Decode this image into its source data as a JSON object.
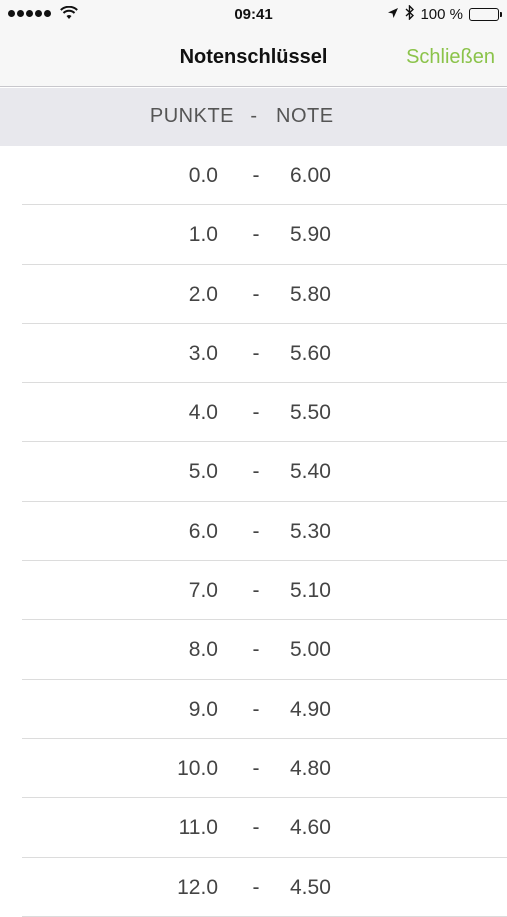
{
  "status_bar": {
    "time": "09:41",
    "battery": "100 %"
  },
  "nav": {
    "title": "Notenschlüssel",
    "close_label": "Schließen"
  },
  "table": {
    "header_points": "PUNKTE",
    "header_dash": "-",
    "header_grade": "NOTE",
    "rows": [
      {
        "points": "0.0",
        "grade": "6.00"
      },
      {
        "points": "1.0",
        "grade": "5.90"
      },
      {
        "points": "2.0",
        "grade": "5.80"
      },
      {
        "points": "3.0",
        "grade": "5.60"
      },
      {
        "points": "4.0",
        "grade": "5.50"
      },
      {
        "points": "5.0",
        "grade": "5.40"
      },
      {
        "points": "6.0",
        "grade": "5.30"
      },
      {
        "points": "7.0",
        "grade": "5.10"
      },
      {
        "points": "8.0",
        "grade": "5.00"
      },
      {
        "points": "9.0",
        "grade": "4.90"
      },
      {
        "points": "10.0",
        "grade": "4.80"
      },
      {
        "points": "11.0",
        "grade": "4.60"
      },
      {
        "points": "12.0",
        "grade": "4.50"
      }
    ],
    "dash": "-"
  },
  "colors": {
    "accent": "#8bc34a",
    "header_bg": "#e8e8ed",
    "bar_bg": "#f7f7f7"
  }
}
